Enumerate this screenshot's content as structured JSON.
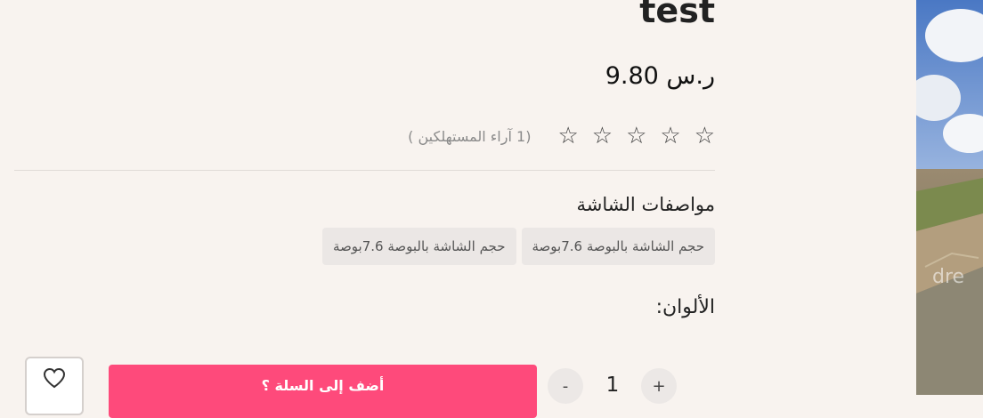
{
  "product": {
    "title": "test",
    "price": "ر.س 9.80",
    "rating": {
      "stars_total": 5,
      "stars_filled": 0,
      "reviews_text": "(1 آراء المستهلكين )"
    }
  },
  "specs": {
    "title": "مواصفات الشاشة",
    "options": [
      "حجم الشاشة بالبوصة 7.6بوصة",
      "حجم الشاشة بالبوصة 7.6بوصة"
    ]
  },
  "colors": {
    "label": "الألوان:"
  },
  "purchase": {
    "quantity": "1",
    "minus_label": "-",
    "plus_label": "+",
    "add_to_cart_label": "أضف إلى السلة ؟"
  },
  "icons": {
    "wishlist": "heart-icon",
    "star": "star-outline-icon"
  },
  "theme": {
    "page_bg": "#f8f3ef",
    "accent": "#fe4a7b",
    "chip_bg": "#ebe7e5"
  }
}
